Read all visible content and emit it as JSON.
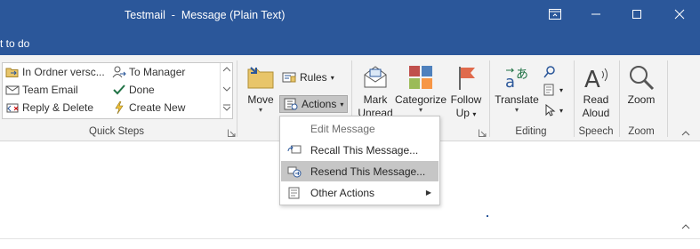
{
  "window": {
    "title": "Testmail  -  Message (Plain Text)",
    "tell_me": "t to do",
    "accent": "#2b579a"
  },
  "quick_steps": {
    "group_label": "Quick Steps",
    "items": [
      {
        "label": "In Ordner versc...",
        "icon": "folder-move-icon"
      },
      {
        "label": "To Manager",
        "icon": "to-manager-icon"
      },
      {
        "label": "Team Email",
        "icon": "team-email-icon"
      },
      {
        "label": "Done",
        "icon": "checkmark-icon"
      },
      {
        "label": "Reply & Delete",
        "icon": "reply-delete-icon"
      },
      {
        "label": "Create New",
        "icon": "lightning-icon"
      }
    ]
  },
  "move_group": {
    "move_label": "Move",
    "rules_label": "Rules",
    "actions_label": "Actions"
  },
  "tags_group": {
    "mark_unread_label": "Mark\nUnread",
    "mark_line1": "Mark",
    "mark_line2": "Unread",
    "categorize_label": "Categorize",
    "follow_line1": "Follow",
    "follow_line2": "Up"
  },
  "editing_group": {
    "group_label": "Editing",
    "translate_label": "Translate"
  },
  "speech_group": {
    "group_label": "Speech",
    "read_line1": "Read",
    "read_line2": "Aloud"
  },
  "zoom_group": {
    "group_label": "Zoom",
    "zoom_label": "Zoom"
  },
  "actions_menu": {
    "items": [
      {
        "label": "Edit Message",
        "state": "disabled"
      },
      {
        "label": "Recall This Message...",
        "state": "normal"
      },
      {
        "label": "Resend This Message...",
        "state": "highlighted"
      },
      {
        "label": "Other Actions",
        "state": "normal",
        "submenu": true
      }
    ]
  }
}
